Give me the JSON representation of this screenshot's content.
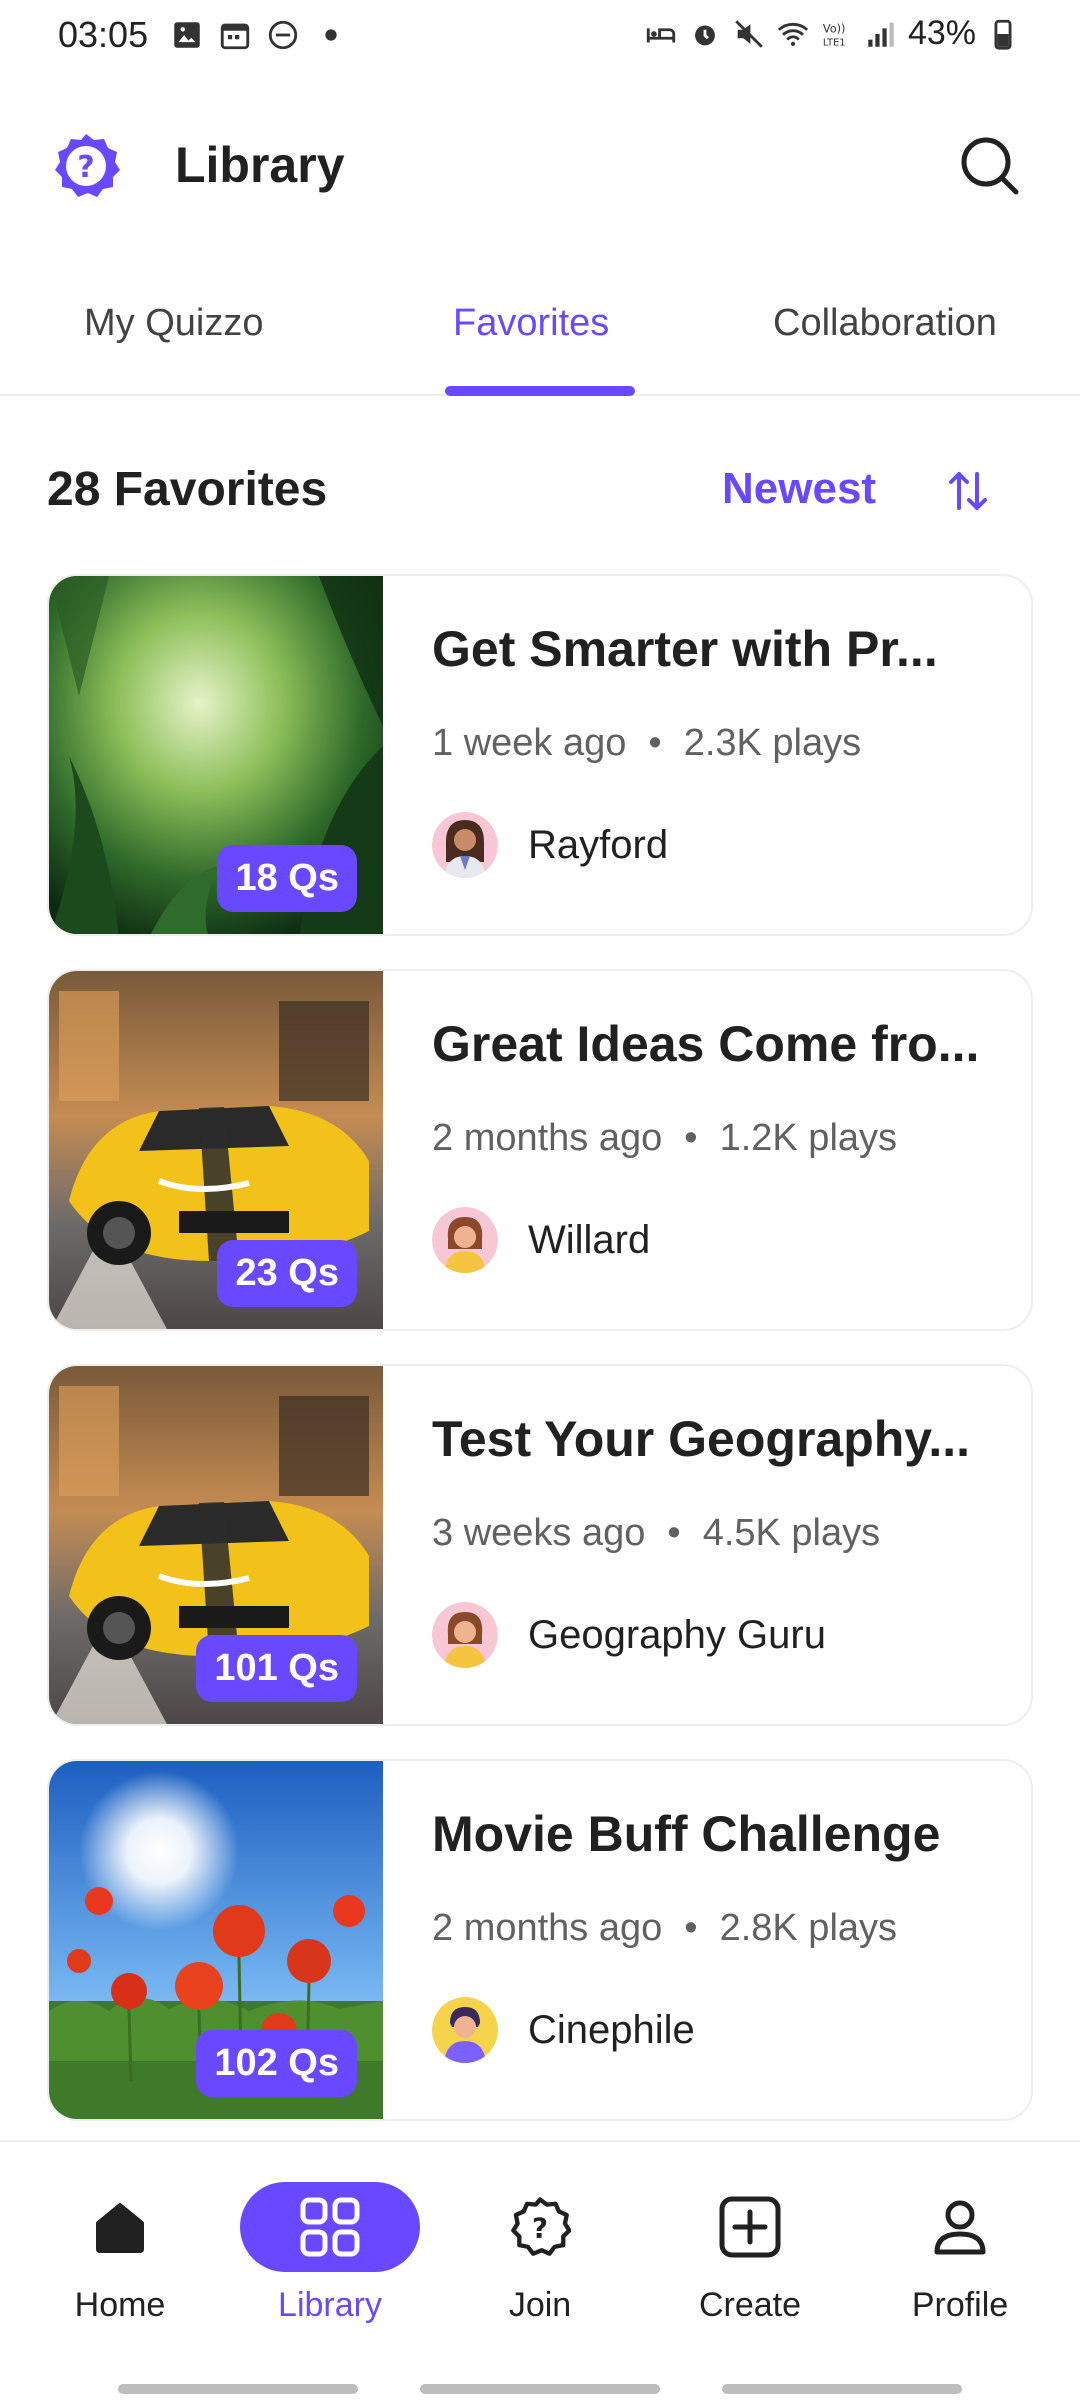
{
  "status_bar": {
    "time": "03:05",
    "battery": "43%"
  },
  "header": {
    "title": "Library"
  },
  "tabs": [
    {
      "label": "My Quizzo"
    },
    {
      "label": "Favorites"
    },
    {
      "label": "Collaboration"
    }
  ],
  "list": {
    "count_label": "28 Favorites",
    "sort_label": "Newest"
  },
  "cards": [
    {
      "title": "Get Smarter with Pr...",
      "time": "1 week ago",
      "plays": "2.3K plays",
      "author": "Rayford",
      "qs": "18 Qs"
    },
    {
      "title": "Great Ideas Come fro...",
      "time": "2 months ago",
      "plays": "1.2K plays",
      "author": "Willard",
      "qs": "23 Qs"
    },
    {
      "title": "Test Your Geography...",
      "time": "3 weeks ago",
      "plays": "4.5K plays",
      "author": "Geography Guru",
      "qs": "101 Qs"
    },
    {
      "title": "Movie Buff Challenge",
      "time": "2 months ago",
      "plays": "2.8K plays",
      "author": "Cinephile",
      "qs": "102 Qs"
    }
  ],
  "bottom_nav": [
    {
      "label": "Home"
    },
    {
      "label": "Library"
    },
    {
      "label": "Join"
    },
    {
      "label": "Create"
    },
    {
      "label": "Profile"
    }
  ],
  "theme": {
    "accent": "#6949ff"
  }
}
